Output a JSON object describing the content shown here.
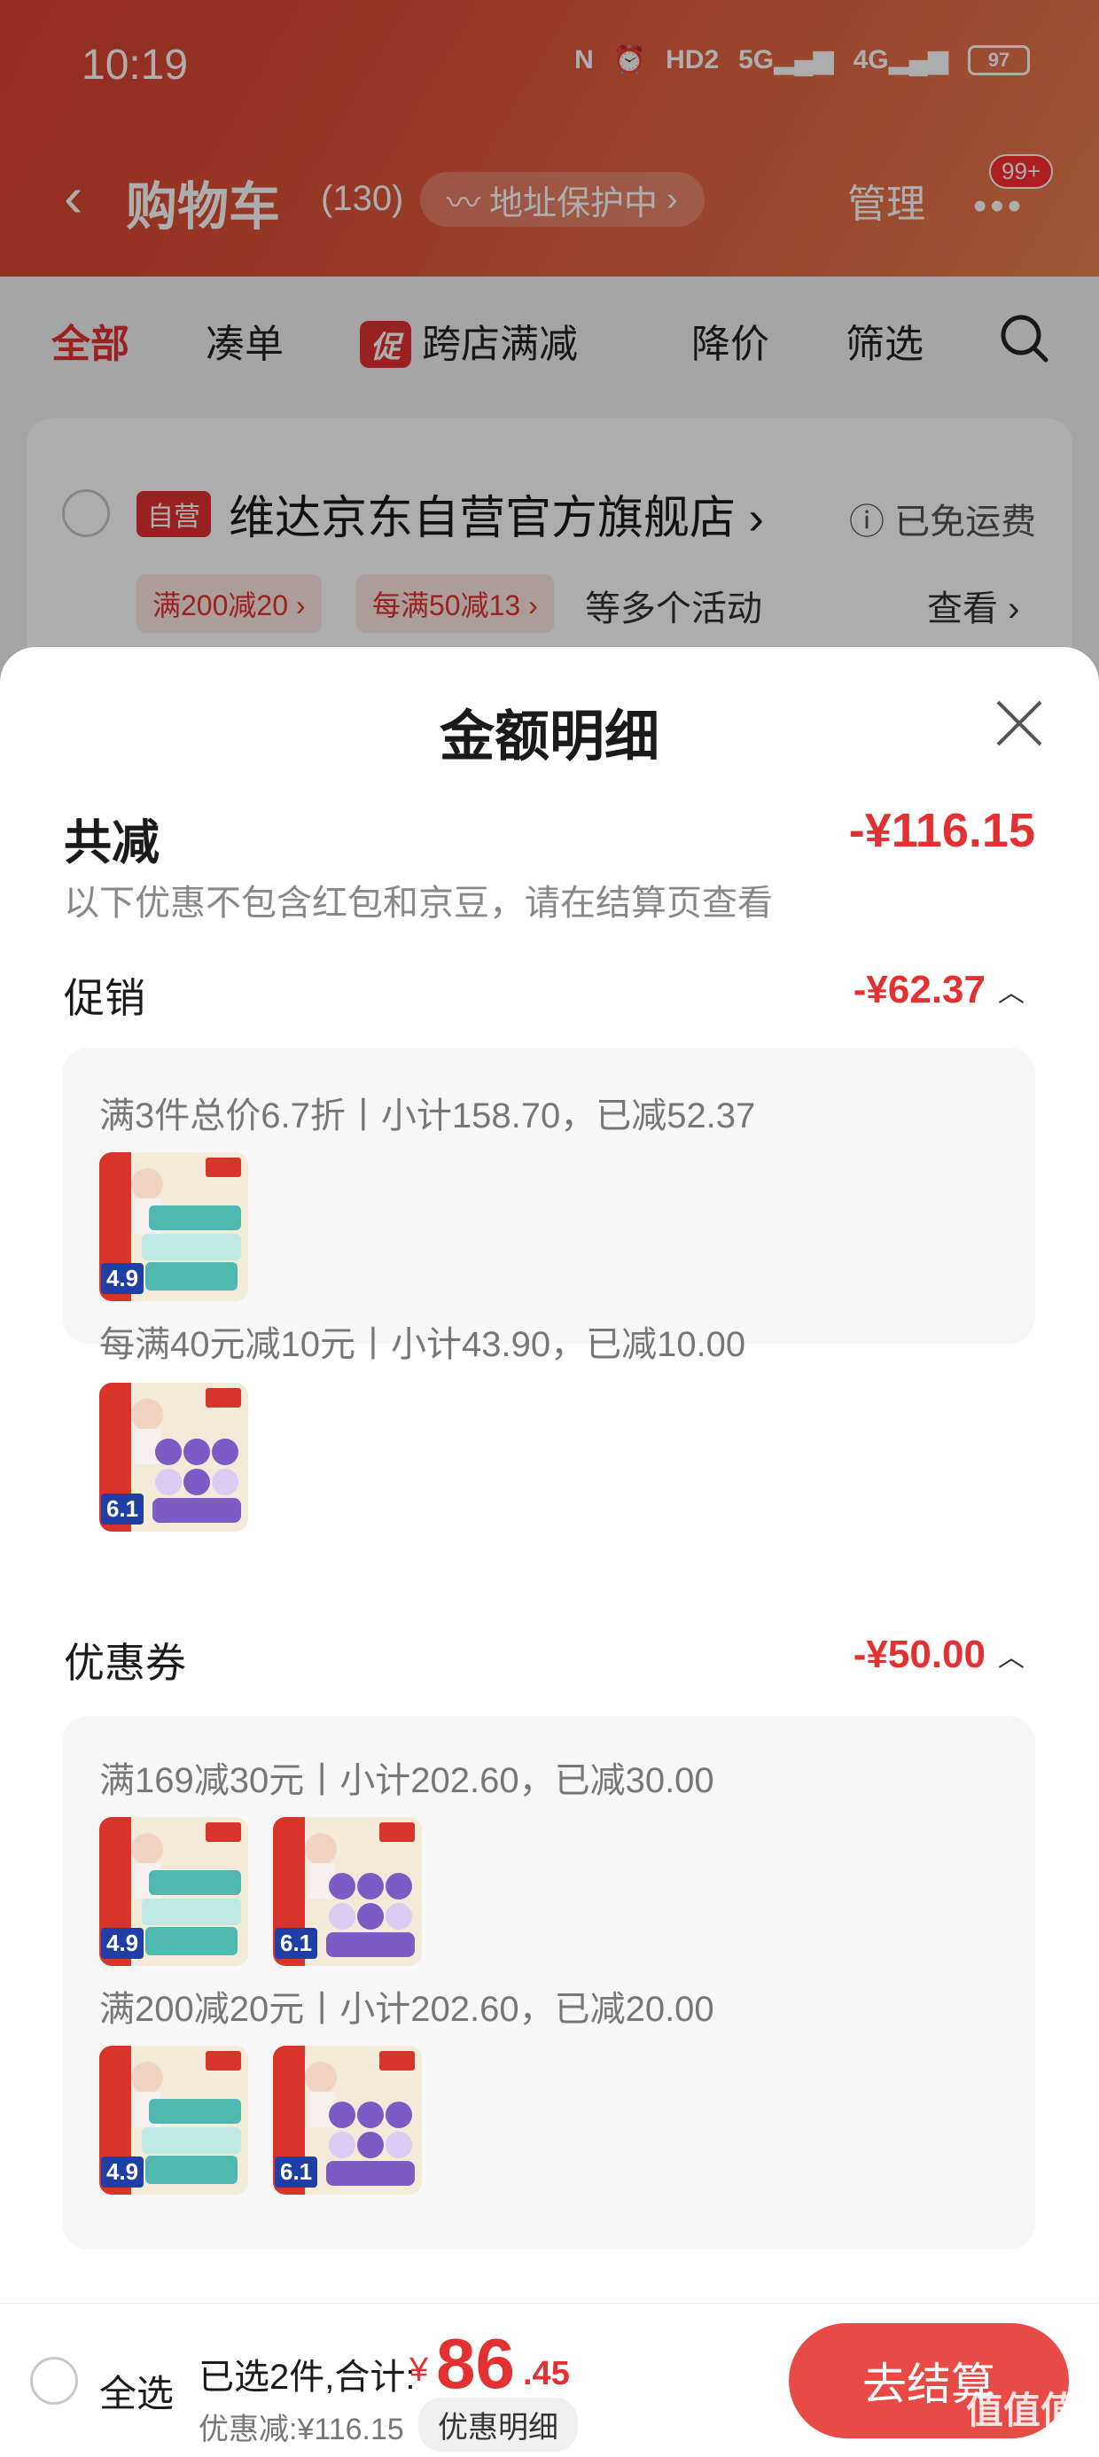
{
  "status_bar": {
    "time": "10:19",
    "network": "5G",
    "network2": "4G",
    "hd": "HD2",
    "battery": "97"
  },
  "header": {
    "title": "购物车",
    "count": "(130)",
    "address_protect": "地址保护中",
    "manage": "管理",
    "badge": "99+"
  },
  "tabs": {
    "all": "全部",
    "bundle": "凑单",
    "promo_tag": "促",
    "cross_store": "跨店满减",
    "price_drop": "降价",
    "filter": "筛选"
  },
  "store": {
    "self_tag": "自营",
    "name": "维达京东自营官方旗舰店",
    "free_shipping": "已免运费",
    "coupons": [
      "满200减20",
      "每满50减13"
    ],
    "activity_text": "等多个活动",
    "view": "查看"
  },
  "sheet": {
    "title": "金额明细",
    "total_label": "共减",
    "total_amount": "-¥116.15",
    "note": "以下优惠不包含红包和京豆，请在结算页查看",
    "promotion": {
      "label": "促销",
      "amount": "-¥62.37",
      "lines": [
        {
          "text": "满3件总价6.7折丨小计158.70，已减52.37",
          "items": [
            {
              "price": "4.9",
              "variant": "teal"
            }
          ]
        },
        {
          "text": "每满40元减10元丨小计43.90，已减10.00",
          "items": [
            {
              "price": "6.1",
              "variant": "purple"
            }
          ]
        }
      ]
    },
    "coupon": {
      "label": "优惠券",
      "amount": "-¥50.00",
      "lines": [
        {
          "text": "满169减30元丨小计202.60，已减30.00",
          "items": [
            {
              "price": "4.9",
              "variant": "teal"
            },
            {
              "price": "6.1",
              "variant": "purple"
            }
          ]
        },
        {
          "text": "满200减20元丨小计202.60，已减20.00",
          "items": [
            {
              "price": "4.9",
              "variant": "teal"
            },
            {
              "price": "6.1",
              "variant": "purple"
            }
          ]
        }
      ]
    }
  },
  "bottom_bar": {
    "select_all": "全选",
    "selected_count": "已选2件,合计:",
    "currency": "¥",
    "total_int": "86",
    "total_dec": ".45",
    "discount": "优惠减:¥116.15",
    "detail_button": "优惠明细",
    "checkout": "去结算",
    "watermark": "值值值"
  },
  "colors": {
    "accent": "#e33131",
    "header_start": "#d9412f",
    "header_end": "#e97d4f"
  }
}
